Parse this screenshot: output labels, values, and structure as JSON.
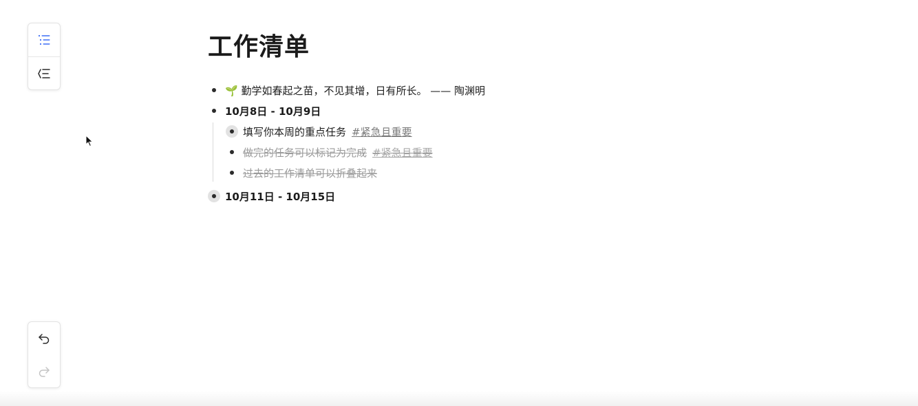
{
  "toolbar": {
    "list_view_icon": "list-icon",
    "outline_view_icon": "outline-collapse-icon",
    "undo_icon": "undo-icon",
    "redo_icon": "redo-icon"
  },
  "document": {
    "title": "工作清单",
    "items": [
      {
        "text": "🌱 勤学如春起之苗，不见其增，日有所长。 —— 陶渊明"
      },
      {
        "text": "10月8日 - 10月9日",
        "children": [
          {
            "text": "填写你本周的重点任务",
            "tag": "#紧急且重要"
          },
          {
            "text": "做完的任务可以标记为完成",
            "tag": "#紧急且重要"
          },
          {
            "text": "过去的工作清单可以折叠起来"
          }
        ]
      },
      {
        "text": "10月11日 - 10月15日"
      }
    ]
  },
  "colors": {
    "accent": "#3d6ef5",
    "text": "#1b1b1b",
    "muted": "#9a9a9a"
  }
}
